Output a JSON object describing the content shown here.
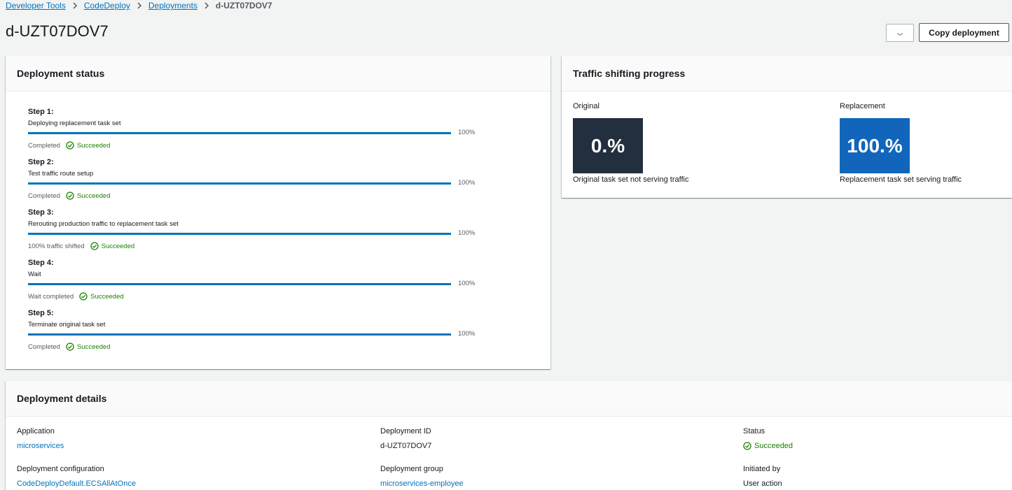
{
  "breadcrumb": {
    "items": [
      "Developer Tools",
      "CodeDeploy",
      "Deployments"
    ],
    "current": "d-UZT07DOV7"
  },
  "header": {
    "title": "d-UZT07DOV7",
    "refresh_icon": "refresh-icon",
    "copy_label": "Copy deployment"
  },
  "status_panel": {
    "title": "Deployment status",
    "steps": [
      {
        "title": "Step 1:",
        "description": "Deploying replacement task set",
        "progress": 100,
        "percent_label": "100%",
        "status_text": "Completed",
        "result": "Succeeded"
      },
      {
        "title": "Step 2:",
        "description": "Test traffic route setup",
        "progress": 100,
        "percent_label": "100%",
        "status_text": "Completed",
        "result": "Succeeded"
      },
      {
        "title": "Step 3:",
        "description": "Rerouting production traffic to replacement task set",
        "progress": 100,
        "percent_label": "100%",
        "status_text": "100% traffic shifted",
        "result": "Succeeded"
      },
      {
        "title": "Step 4:",
        "description": "Wait",
        "progress": 100,
        "percent_label": "100%",
        "status_text": "Wait completed",
        "result": "Succeeded"
      },
      {
        "title": "Step 5:",
        "description": "Terminate original task set",
        "progress": 100,
        "percent_label": "100%",
        "status_text": "Completed",
        "result": "Succeeded"
      }
    ]
  },
  "traffic_panel": {
    "title": "Traffic shifting progress",
    "original": {
      "label": "Original",
      "value": "0.%",
      "caption": "Original task set not serving traffic",
      "color": "#232f3e"
    },
    "replacement": {
      "label": "Replacement",
      "value": "100.%",
      "caption": "Replacement task set serving traffic",
      "color": "#1166bb"
    }
  },
  "details_panel": {
    "title": "Deployment details",
    "application": {
      "label": "Application",
      "value": "microservices"
    },
    "deployment_id": {
      "label": "Deployment ID",
      "value": "d-UZT07DOV7"
    },
    "status": {
      "label": "Status",
      "value": "Succeeded"
    },
    "deployment_configuration": {
      "label": "Deployment configuration",
      "value": "CodeDeployDefault.ECSAllAtOnce"
    },
    "deployment_group": {
      "label": "Deployment group",
      "value": "microservices-employee"
    },
    "initiated_by": {
      "label": "Initiated by",
      "value": "User action"
    }
  },
  "colors": {
    "accent": "#0073bb",
    "success": "#1d8102"
  }
}
